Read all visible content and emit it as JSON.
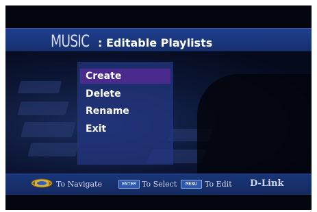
{
  "header": {
    "section": "MUSIC",
    "subtitle": ": Editable Playlists"
  },
  "menu": {
    "items": [
      {
        "label": "Create",
        "selected": true
      },
      {
        "label": "Delete",
        "selected": false
      },
      {
        "label": "Rename",
        "selected": false
      },
      {
        "label": "Exit",
        "selected": false
      }
    ]
  },
  "footer": {
    "navigate_icon": "dpad-icon",
    "navigate_label": "To Navigate",
    "enter_key": "ENTER",
    "select_label": "To Select",
    "menu_key": "MENU",
    "edit_label": "To Edit",
    "brand": "D-Link"
  },
  "colors": {
    "header": "#1f3e8e",
    "selected_item": "#4a2a8c",
    "panel": "#243882"
  }
}
